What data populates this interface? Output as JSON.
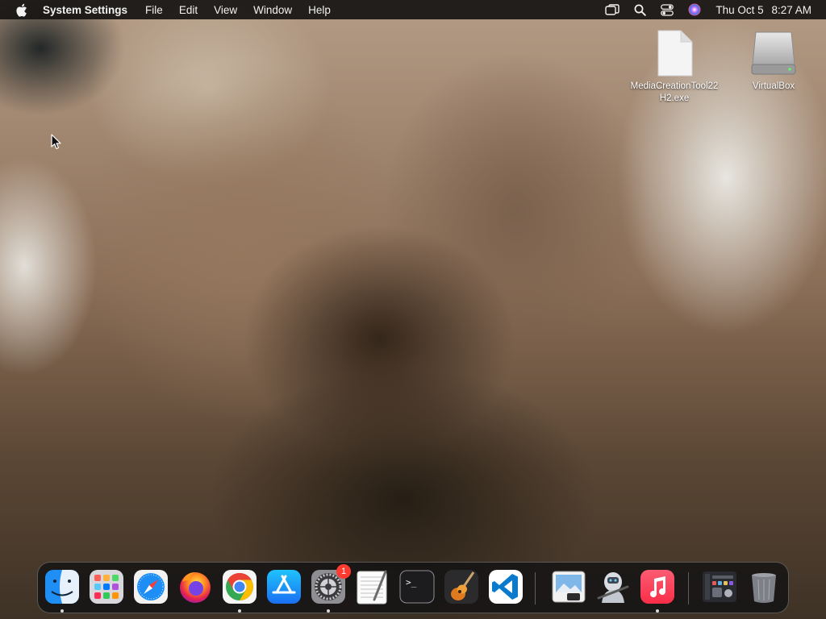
{
  "menubar": {
    "app_name": "System Settings",
    "menus": [
      "File",
      "Edit",
      "View",
      "Window",
      "Help"
    ],
    "status_icons": [
      "window-icon",
      "search-icon",
      "control-center-icon",
      "siri-icon"
    ],
    "clock": {
      "day_date": "Thu Oct 5",
      "time": "8:27 AM"
    }
  },
  "desktop": {
    "icons": [
      {
        "label": "MediaCreationTool22H2.exe",
        "icon": "document-icon"
      },
      {
        "label": "VirtualBox",
        "icon": "drive-icon"
      }
    ]
  },
  "dock": {
    "apps": [
      {
        "name": "Finder",
        "icon": "finder-icon",
        "running": true
      },
      {
        "name": "Launchpad",
        "icon": "launchpad-icon",
        "running": false
      },
      {
        "name": "Safari",
        "icon": "safari-icon",
        "running": false
      },
      {
        "name": "Firefox",
        "icon": "firefox-icon",
        "running": false
      },
      {
        "name": "Google Chrome",
        "icon": "chrome-icon",
        "running": true
      },
      {
        "name": "App Store",
        "icon": "app-store-icon",
        "running": false
      },
      {
        "name": "System Settings",
        "icon": "settings-icon",
        "running": true,
        "badge": "1"
      },
      {
        "name": "TextEdit",
        "icon": "textedit-icon",
        "running": false
      },
      {
        "name": "Terminal",
        "icon": "terminal-icon",
        "running": false
      },
      {
        "name": "GarageBand",
        "icon": "garageband-icon",
        "running": false
      },
      {
        "name": "Visual Studio Code",
        "icon": "vscode-icon",
        "running": false
      },
      {
        "name": "Preview",
        "icon": "preview-icon",
        "running": false
      },
      {
        "name": "Automator",
        "icon": "automator-icon",
        "running": false
      },
      {
        "name": "Music",
        "icon": "music-icon",
        "running": true
      },
      {
        "name": "Screenshot",
        "icon": "screenshot-icon",
        "running": false
      },
      {
        "name": "Trash",
        "icon": "trash-icon",
        "running": false
      }
    ],
    "terminal_prompt": ">_"
  },
  "colors": {
    "menubar_bg": "#161412",
    "badge": "#ff3b30",
    "vscode_blue": "#0a7acc",
    "music_red": "#fa2d48"
  }
}
